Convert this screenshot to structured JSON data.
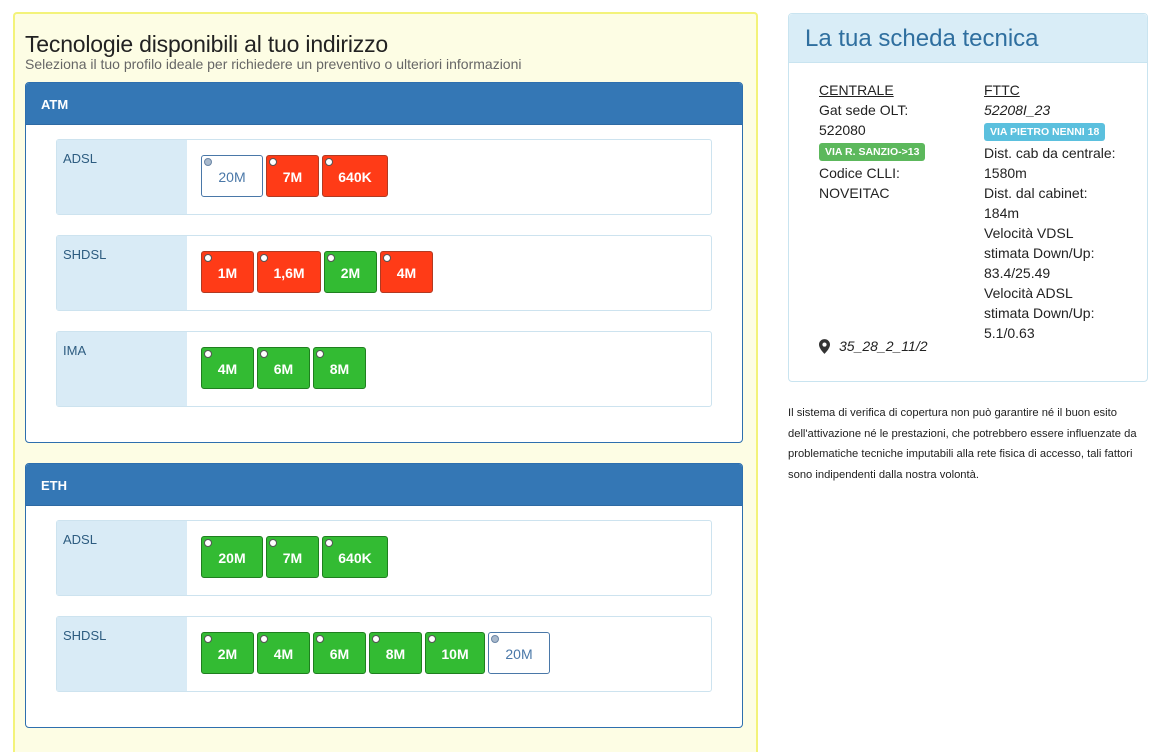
{
  "main": {
    "title": "Tecnologie disponibili al tuo indirizzo",
    "subtitle": "Seleziona il tuo profilo ideale per richiedere un preventivo o ulteriori informazioni",
    "groups": [
      {
        "name": "ATM",
        "rows": [
          {
            "label": "ADSL",
            "speeds": [
              {
                "label": "20M",
                "status": "white"
              },
              {
                "label": "7M",
                "status": "red"
              },
              {
                "label": "640K",
                "status": "red"
              }
            ]
          },
          {
            "label": "SHDSL",
            "speeds": [
              {
                "label": "1M",
                "status": "red"
              },
              {
                "label": "1,6M",
                "status": "red"
              },
              {
                "label": "2M",
                "status": "green"
              },
              {
                "label": "4M",
                "status": "red"
              }
            ]
          },
          {
            "label": "IMA",
            "speeds": [
              {
                "label": "4M",
                "status": "green"
              },
              {
                "label": "6M",
                "status": "green"
              },
              {
                "label": "8M",
                "status": "green"
              }
            ]
          }
        ]
      },
      {
        "name": "ETH",
        "rows": [
          {
            "label": "ADSL",
            "speeds": [
              {
                "label": "20M",
                "status": "green"
              },
              {
                "label": "7M",
                "status": "green"
              },
              {
                "label": "640K",
                "status": "green"
              }
            ]
          },
          {
            "label": "SHDSL",
            "speeds": [
              {
                "label": "2M",
                "status": "green"
              },
              {
                "label": "4M",
                "status": "green"
              },
              {
                "label": "6M",
                "status": "green"
              },
              {
                "label": "8M",
                "status": "green"
              },
              {
                "label": "10M",
                "status": "green"
              },
              {
                "label": "20M",
                "status": "white"
              }
            ]
          }
        ]
      }
    ]
  },
  "card": {
    "title": "La tua scheda tecnica",
    "left": {
      "heading": "CENTRALE",
      "gat_label": "Gat sede OLT:",
      "gat_value": "522080",
      "badge": "VIA R. SANZIO->13",
      "clli_label": "Codice CLLI:",
      "clli_value": "NOVEITAC"
    },
    "right": {
      "heading": "FTTC",
      "code": "52208I_23",
      "badge": "VIA PIETRO NENNI 18",
      "dist_central_label": "Dist. cab da centrale:",
      "dist_central_value": "1580m",
      "dist_cabinet_label": "Dist. dal cabinet:",
      "dist_cabinet_value": "184m",
      "vdsl_label_1": "Velocità VDSL",
      "vdsl_label_2": "stimata Down/Up:",
      "vdsl_value": "83.4/25.49",
      "adsl_label_1": "Velocità ADSL",
      "adsl_label_2": "stimata Down/Up:",
      "adsl_value": "5.1/0.63"
    },
    "location": "35_28_2_11/2",
    "location_icon": "map-marker-icon"
  },
  "disclaimer": "Il sistema di verifica di copertura non può garantire né il buon esito dell'attivazione né le prestazioni, che potrebbero essere influenzate da problematiche tecniche imputabili alla rete fisica di accesso, tali fattori sono indipendenti dalla nostra volontà.",
  "colors": {
    "red": "#ff3b17",
    "green": "#33bb33",
    "header_blue": "#3477b5",
    "panel_yellow": "#fdfde4"
  }
}
